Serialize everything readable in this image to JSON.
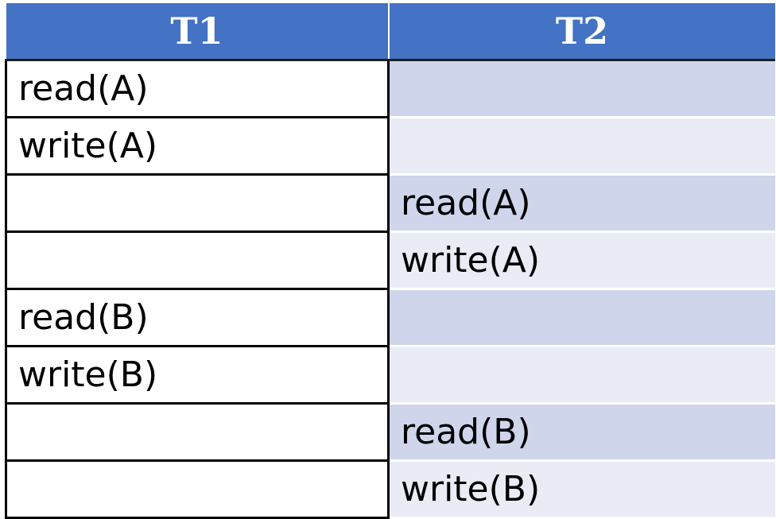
{
  "headers": [
    "T1",
    "T2"
  ],
  "rows": [
    {
      "t1": "read(A)",
      "t2": ""
    },
    {
      "t1": "write(A)",
      "t2": ""
    },
    {
      "t1": "",
      "t2": "read(A)"
    },
    {
      "t1": "",
      "t2": "write(A)"
    },
    {
      "t1": "read(B)",
      "t2": ""
    },
    {
      "t1": "write(B)",
      "t2": ""
    },
    {
      "t1": "",
      "t2": "read(B)"
    },
    {
      "t1": "",
      "t2": "write(B)"
    }
  ],
  "highlight_color": "#ff0000",
  "highlighted_cells": [
    "rows.1.t1",
    "rows.2.t2"
  ],
  "colors": {
    "header_bg": "#4472c4",
    "header_text": "#ffffff",
    "t2_band_dark": "#cfd5ea",
    "t2_band_light": "#e9ebf5"
  }
}
